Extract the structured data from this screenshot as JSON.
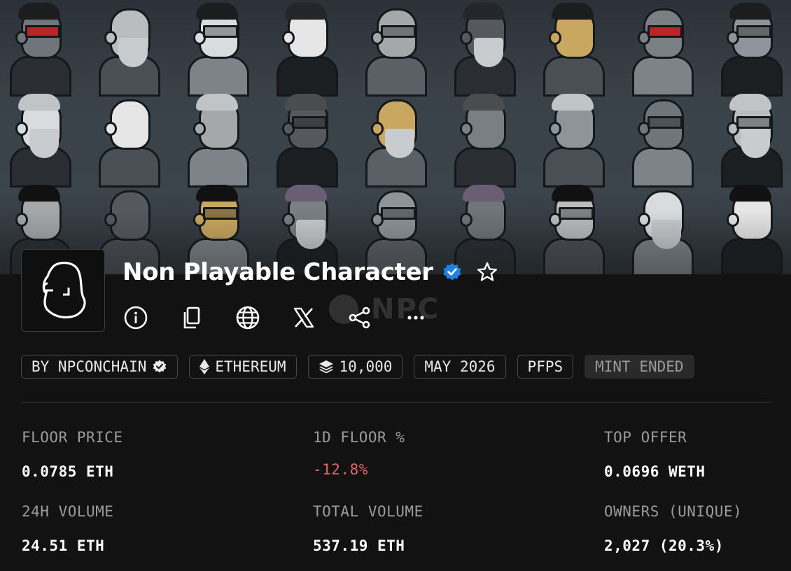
{
  "collection": {
    "title": "Non Playable Character",
    "verified": true,
    "logo_icon": "npc-face-icon",
    "watermark_text": "NPC"
  },
  "actions": [
    {
      "name": "info-icon"
    },
    {
      "name": "copy-icon"
    },
    {
      "name": "website-globe-icon"
    },
    {
      "name": "x-twitter-icon"
    },
    {
      "name": "share-icon"
    },
    {
      "name": "more-options-icon"
    }
  ],
  "chips": {
    "creator": "BY NPCONCHAIN",
    "chain": "ETHEREUM",
    "items": "10,000",
    "date": "MAY 2026",
    "category": "PFPS",
    "mint_status": "MINT ENDED"
  },
  "stats": {
    "floor_price": {
      "label": "FLOOR PRICE",
      "value": "0.0785 ETH"
    },
    "floor_change": {
      "label": "1D FLOOR %",
      "value": "-12.8%"
    },
    "top_offer": {
      "label": "TOP OFFER",
      "value": "0.0696 WETH"
    },
    "volume_24h": {
      "label": "24H VOLUME",
      "value": "24.51 ETH"
    },
    "total_volume": {
      "label": "TOTAL VOLUME",
      "value": "537.19 ETH"
    },
    "owners": {
      "label": "OWNERS (UNIQUE)",
      "value": "2,027 (20.3%)"
    }
  },
  "colors": {
    "background": "#121212",
    "verified_badge": "#2081e2",
    "negative": "#e0676a",
    "label": "#9b9b9b"
  }
}
